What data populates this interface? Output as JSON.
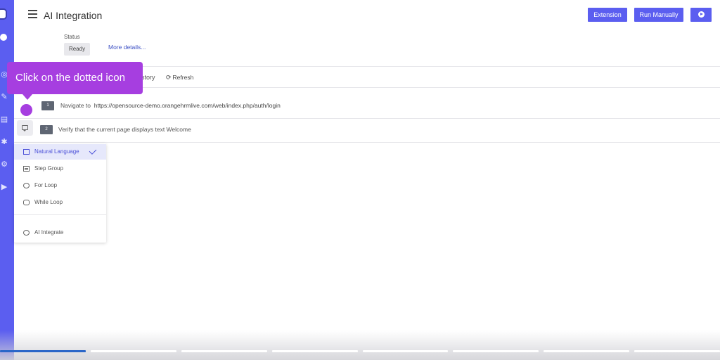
{
  "header": {
    "title": "AI Integration",
    "buttons": {
      "extension": "Extension",
      "run_manually": "Run Manually"
    }
  },
  "status": {
    "label": "Status",
    "value": "Ready",
    "more_details": "More details..."
  },
  "toolbar": {
    "history_fragment": "story",
    "refresh": "Refresh"
  },
  "steps": [
    {
      "number": "1",
      "action": "Navigate to",
      "target": "https://opensource-demo.orangehrmlive.com/web/index.php/auth/login"
    },
    {
      "number": "2",
      "action": "Verify that the current page displays text Welcome",
      "target": ""
    }
  ],
  "step_type_menu": {
    "items": [
      {
        "label": "Natural Language",
        "icon": "speech-bubble-icon",
        "selected": true
      },
      {
        "label": "Step Group",
        "icon": "list-icon",
        "selected": false
      },
      {
        "label": "For Loop",
        "icon": "loop-circle-icon",
        "selected": false
      },
      {
        "label": "While Loop",
        "icon": "while-loop-icon",
        "selected": false
      },
      {
        "label": "AI Integrate",
        "icon": "ai-circle-icon",
        "selected": false
      }
    ]
  },
  "tooltip": {
    "text": "Click on the dotted icon"
  },
  "video_progress": {
    "segments_total": 8,
    "segments_complete": 1
  },
  "colors": {
    "accent": "#5b5ef0",
    "tooltip": "#a63ee0",
    "progress": "#2a66c8"
  }
}
